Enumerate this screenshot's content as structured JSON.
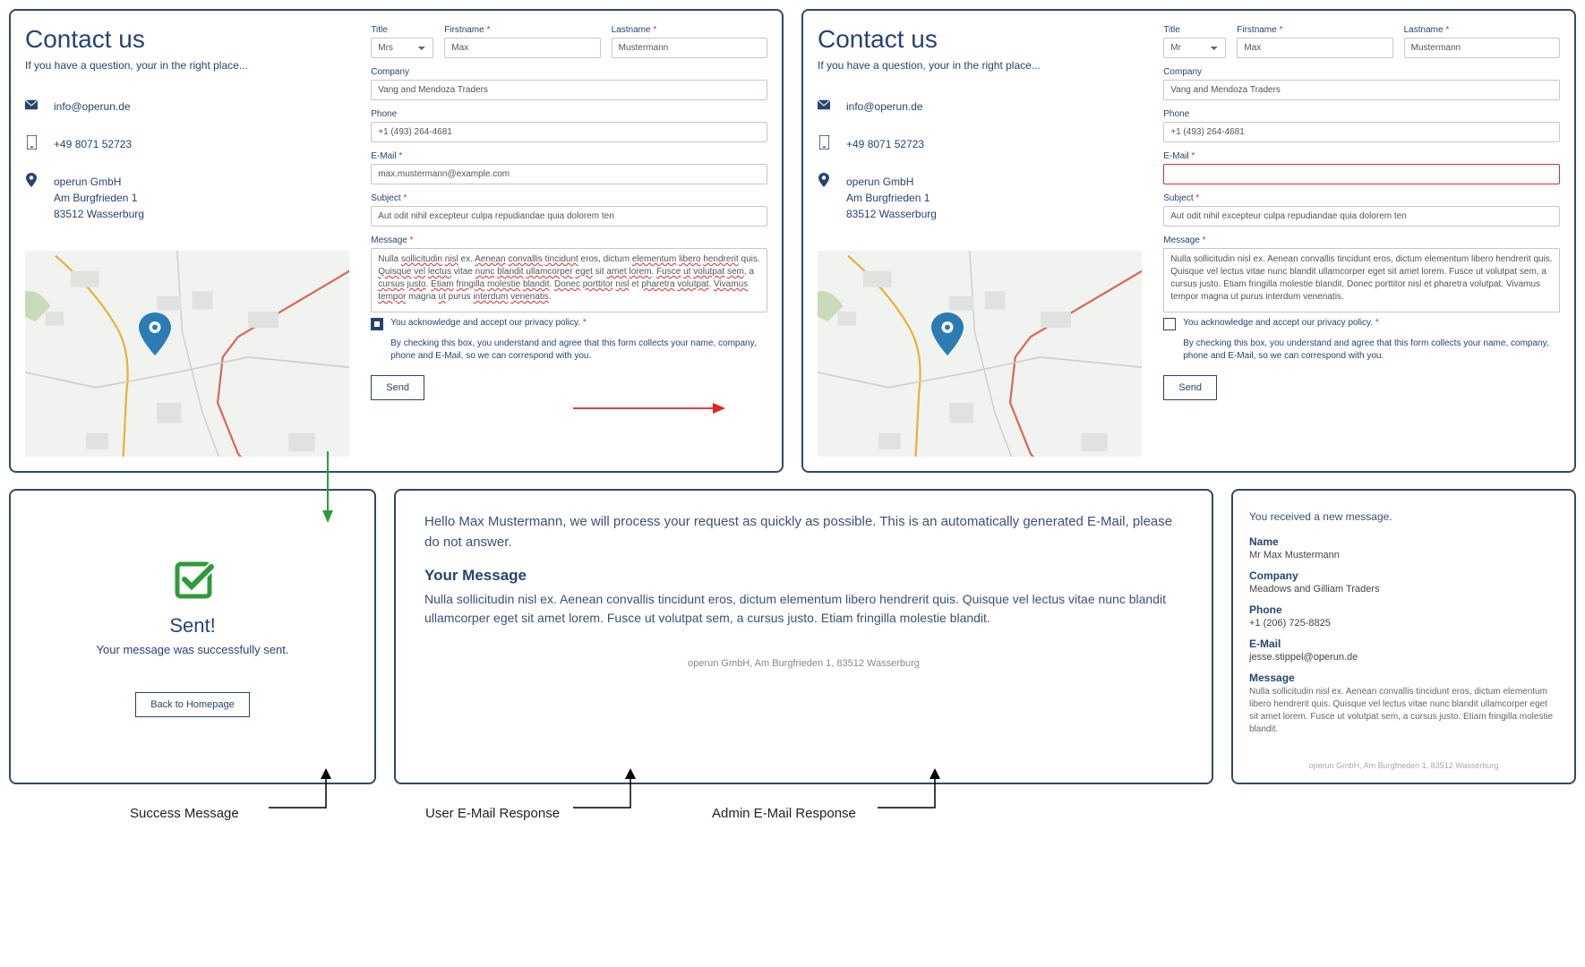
{
  "form": {
    "title": "Contact us",
    "subtitle": "If you have a question, your in the right place...",
    "email": "info@operun.de",
    "phone": "+49 8071 52723",
    "address_line1": "operun GmbH",
    "address_line2": "Am Burgfrieden 1",
    "address_line3": "83512 Wasserburg",
    "labels": {
      "title": "Title",
      "firstname": "Firstname",
      "lastname": "Lastname",
      "company": "Company",
      "phone": "Phone",
      "email": "E-Mail",
      "subject": "Subject",
      "message": "Message"
    },
    "values_a": {
      "title": "Mrs",
      "firstname": "Max",
      "lastname": "Mustermann",
      "company": "Vang and Mendoza Traders",
      "phone": "+1 (493) 264-4681",
      "email": "max.mustermann@example.com",
      "subject": "Aut odit nihil excepteur culpa repudiandae quia dolorem ten",
      "checkbox": true
    },
    "values_b": {
      "title": "Mr",
      "firstname": "Max",
      "lastname": "Mustermann",
      "company": "Vang and Mendoza Traders",
      "phone": "+1 (493) 264-4681",
      "email": "",
      "subject": "Aut odit nihil excepteur culpa repudiandae quia dolorem ten",
      "checkbox": false
    },
    "message_text": "Nulla sollicitudin nisl ex. Aenean convallis tincidunt eros, dictum elementum libero hendrerit quis. Quisque vel lectus vitae nunc blandit ullamcorper eget sit amet lorem. Fusce ut volutpat sem, a cursus justo. Etiam fringilla molestie blandit. Donec porttitor nisl et pharetra volutpat. Vivamus tempor magna ut purus interdum venenatis.",
    "privacy_label": "You acknowledge and accept our privacy policy.",
    "privacy_help": "By checking this box, you understand and agree that this form collects your name, company, phone and E-Mail, so we can correspond with you.",
    "send_label": "Send"
  },
  "success": {
    "title": "Sent!",
    "text": "Your message was successfully sent.",
    "button": "Back to Homepage"
  },
  "user_email": {
    "greeting": "Hello Max Mustermann, we will process your request as quickly as possible. This is an automatically generated E-Mail, please do not answer.",
    "heading": "Your Message",
    "body": "Nulla sollicitudin nisl ex. Aenean convallis tincidunt eros, dictum elementum libero hendrerit quis. Quisque vel lectus vitae nunc blandit ullamcorper eget sit amet lorem. Fusce ut volutpat sem, a cursus justo. Etiam fringilla molestie blandit.",
    "footer": "operun GmbH, Am Burgfrieden 1, 83512 Wasserburg"
  },
  "admin_email": {
    "top": "You received a new message.",
    "name_label": "Name",
    "name": "Mr Max Mustermann",
    "company_label": "Company",
    "company": "Meadows and Gilliam Traders",
    "phone_label": "Phone",
    "phone": "+1 (206) 725-8825",
    "email_label": "E-Mail",
    "email": "jesse.stippel@operun.de",
    "message_label": "Message",
    "message": "Nulla sollicitudin nisl ex. Aenean convallis tincidunt eros, dictum elementum libero hendrerit quis. Quisque vel lectus vitae nunc blandit ullamcorper eget sit amet lorem. Fusce ut volutpat sem, a cursus justo. Etiam fringilla molestie blandit.",
    "footer": "operun GmbH, Am Burgfrieden 1, 83512 Wasserburg"
  },
  "captions": {
    "success": "Success Message",
    "user": "User E-Mail Response",
    "admin": "Admin E-Mail Response"
  }
}
